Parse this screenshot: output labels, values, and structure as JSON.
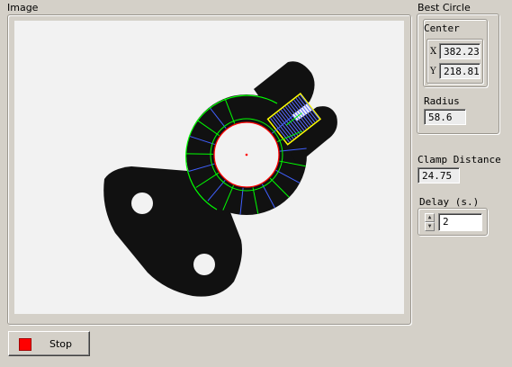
{
  "image_panel": {
    "title": "Image"
  },
  "best_circle": {
    "title": "Best Circle",
    "center": {
      "title": "Center",
      "x_label": "X",
      "x_value": "382.23",
      "y_label": "Y",
      "y_value": "218.81"
    },
    "radius": {
      "label": "Radius",
      "value": "58.6"
    }
  },
  "clamp_distance": {
    "label": "Clamp Distance",
    "value": "24.75"
  },
  "delay": {
    "label": "Delay (s.)",
    "value": "2"
  },
  "stop_button": {
    "label": "Stop"
  },
  "colors": {
    "stop_icon": "#ff0000",
    "window_bg": "#d4d0c8",
    "fit_circle_red": "#ff0000",
    "edge_green": "#00ff00",
    "measure_blue": "#0000ff",
    "roi_yellow": "#ffff00"
  },
  "icons": {
    "stop": "stop-square-icon",
    "spin_up": "spin-up-icon",
    "spin_down": "spin-down-icon"
  }
}
